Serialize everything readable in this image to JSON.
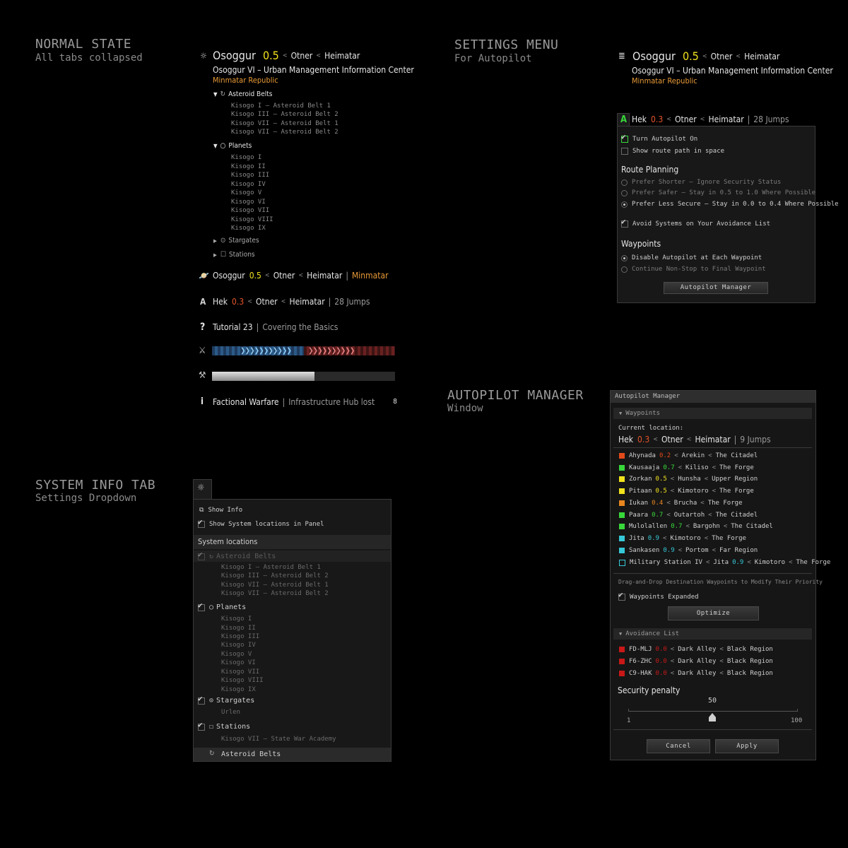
{
  "sections": {
    "normal": {
      "title": "NORMAL STATE",
      "sub": "All tabs collapsed"
    },
    "settings": {
      "title": "SETTINGS MENU",
      "sub": "For Autopilot"
    },
    "sysinfo": {
      "title": "SYSTEM INFO TAB",
      "sub": "Settings Dropdown"
    },
    "apmgr": {
      "title": "AUTOPILOT MANAGER",
      "sub": "Window"
    }
  },
  "colors": {
    "sec05": "#f2e21c",
    "sec03": "#e2542a",
    "sec02": "#e24a1a",
    "sec04": "#e8861f",
    "sec07": "#38d83a",
    "sec09": "#36c8d8",
    "sec00": "#c81818",
    "accent": "#e89a38"
  },
  "header": {
    "system": "Osoggur",
    "security": "0.5",
    "constellation": "Otner",
    "region": "Heimatar",
    "station": "Osoggur VI – Urban Management Information Center",
    "faction": "Minmatar Republic"
  },
  "tree": {
    "belts_label": "Asteroid Belts",
    "belts": [
      "Kisogo I – Asteroid Belt 1",
      "Kisogo III – Asteroid Belt 2",
      "Kisogo VII – Asteroid Belt 1",
      "Kisogo VII – Asteroid Belt 2"
    ],
    "planets_label": "Planets",
    "planets": [
      "Kisogo I",
      "Kisogo II",
      "Kisogo III",
      "Kisogo IV",
      "Kisogo V",
      "Kisogo VI",
      "Kisogo VII",
      "Kisogo VIII",
      "Kisogo  IX"
    ],
    "stargates_label": "Stargates",
    "stations_label": "Stations"
  },
  "location_row": {
    "system": "Osoggur",
    "security": "0.5",
    "constellation": "Otner",
    "region": "Heimatar",
    "faction": "Minmatar"
  },
  "route_row": {
    "system": "Hek",
    "security": "0.3",
    "constellation": "Otner",
    "region": "Heimatar",
    "jumps": "28 Jumps"
  },
  "tutorial_row": {
    "label": "Tutorial 23",
    "sub": "Covering the Basics"
  },
  "fw_row": {
    "label": "Factional Warfare",
    "sub": "Infrastructure Hub lost",
    "count": "8"
  },
  "progress": {
    "fill": 0.56
  },
  "autopilot_settings": {
    "turn_on": "Turn Autopilot On",
    "show_route": "Show route path in space",
    "route_planning": "Route Planning",
    "opt1": "Prefer Shorter – Ignore Security Status",
    "opt2": "Prefer Safer – Stay in 0.5 to 1.0 Where Possible",
    "opt3": "Prefer Less Secure – Stay in 0.0 to 0.4 Where Possible",
    "avoid": "Avoid Systems on Your Avoidance List",
    "waypoints": "Waypoints",
    "wp1": "Disable Autopilot at Each Waypoint",
    "wp2": "Continue Non-Stop to Final Waypoint",
    "manager_btn": "Autopilot Manager",
    "autopilot_icon": "A"
  },
  "sysinfo_panel": {
    "show_info": "Show Info",
    "show_locations": "Show System locations in Panel",
    "system_locations": "System locations",
    "belts_label": "Asteroid Belts",
    "planets_label": "Planets",
    "stargates_label": "Stargates",
    "stargate_items": [
      "Urlen"
    ],
    "stations_label": "Stations",
    "station_items": [
      "Kisogo VII – State War Academy"
    ],
    "footer": "Asteroid Belts"
  },
  "manager": {
    "title": "Autopilot Manager",
    "waypoints_hdr": "Waypoints",
    "current_location": "Current location:",
    "cur": {
      "system": "Hek",
      "security": "0.3",
      "constellation": "Otner",
      "region": "Heimatar",
      "jumps": "9 Jumps"
    },
    "waypoints": [
      {
        "name": "Ahynada",
        "sec": "0.2",
        "color": "#e24a1a",
        "const": "Arekin",
        "region": "The Citadel"
      },
      {
        "name": "Kausaaja",
        "sec": "0.7",
        "color": "#38d83a",
        "const": "Kiliso",
        "region": "The Forge"
      },
      {
        "name": "Zorkan",
        "sec": "0.5",
        "color": "#f2e21c",
        "const": "Hunsha",
        "region": "Upper Region"
      },
      {
        "name": "Pitaan",
        "sec": "0.5",
        "color": "#f2e21c",
        "const": "Kimotoro",
        "region": "The Forge"
      },
      {
        "name": "Iukan",
        "sec": "0.4",
        "color": "#e8861f",
        "const": "Brucha",
        "region": "The Forge"
      },
      {
        "name": "Paara",
        "sec": "0.7",
        "color": "#38d83a",
        "const": "Outartoh",
        "region": "The Citadel"
      },
      {
        "name": "Mulolallen",
        "sec": "0.7",
        "color": "#38d83a",
        "const": "Bargohn",
        "region": "The Citadel"
      },
      {
        "name": "Jita",
        "sec": "0.9",
        "color": "#36c8d8",
        "const": "Kimotoro",
        "region": "The Forge"
      },
      {
        "name": "Sankasen",
        "sec": "0.9",
        "color": "#36c8d8",
        "const": "Portom",
        "region": "Far Region"
      }
    ],
    "station_wp": {
      "name": "Military Station IV",
      "system": "Jita",
      "sec": "0.9",
      "const": "Kimotoro",
      "region": "The Forge"
    },
    "drag_hint": "Drag-and-Drop Destination Waypoints to Modify Their Priority",
    "expanded": "Waypoints Expanded",
    "optimize": "Optimize",
    "avoid_hdr": "Avoidance List",
    "avoid": [
      {
        "name": "FD-MLJ",
        "sec": "0.0",
        "const": "Dark Alley",
        "region": "Black Region"
      },
      {
        "name": "F6-ZHC",
        "sec": "0.0",
        "const": "Dark Alley",
        "region": "Black Region"
      },
      {
        "name": "C9-HAK",
        "sec": "0.0",
        "const": "Dark Alley",
        "region": "Black Region"
      }
    ],
    "penalty_label": "Security penalty",
    "penalty_value": "50",
    "penalty_min": "1",
    "penalty_max": "100",
    "cancel": "Cancel",
    "apply": "Apply"
  }
}
